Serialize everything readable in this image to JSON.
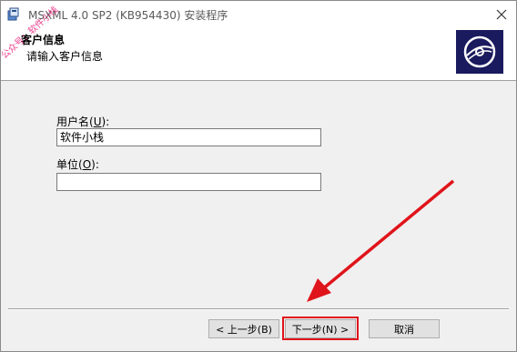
{
  "window": {
    "title": "MSXML 4.0 SP2 (KB954430) 安装程序"
  },
  "header": {
    "title": "客户信息",
    "subtitle": "请输入客户信息",
    "watermark": "公众号：软件小栈"
  },
  "form": {
    "username_label_prefix": "用户名(",
    "username_label_key": "U",
    "username_label_suffix": "):",
    "username_value": "软件小栈",
    "org_label_prefix": "单位(",
    "org_label_key": "O",
    "org_label_suffix": "):",
    "org_value": ""
  },
  "buttons": {
    "back": "< 上一步(B)",
    "next": "下一步(N) >",
    "cancel": "取消"
  },
  "colors": {
    "highlight": "#e0141b",
    "logo_bg": "#1a1a5e"
  },
  "icons": {
    "app": "installer-icon",
    "logo": "cd-disc-icon",
    "close": "close-icon"
  }
}
